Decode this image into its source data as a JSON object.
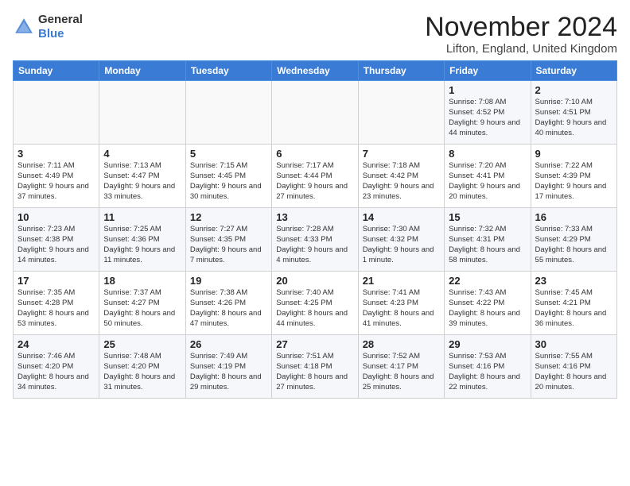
{
  "logo": {
    "general": "General",
    "blue": "Blue"
  },
  "title": "November 2024",
  "location": "Lifton, England, United Kingdom",
  "days_of_week": [
    "Sunday",
    "Monday",
    "Tuesday",
    "Wednesday",
    "Thursday",
    "Friday",
    "Saturday"
  ],
  "weeks": [
    [
      {
        "day": "",
        "info": ""
      },
      {
        "day": "",
        "info": ""
      },
      {
        "day": "",
        "info": ""
      },
      {
        "day": "",
        "info": ""
      },
      {
        "day": "",
        "info": ""
      },
      {
        "day": "1",
        "info": "Sunrise: 7:08 AM\nSunset: 4:52 PM\nDaylight: 9 hours and 44 minutes."
      },
      {
        "day": "2",
        "info": "Sunrise: 7:10 AM\nSunset: 4:51 PM\nDaylight: 9 hours and 40 minutes."
      }
    ],
    [
      {
        "day": "3",
        "info": "Sunrise: 7:11 AM\nSunset: 4:49 PM\nDaylight: 9 hours and 37 minutes."
      },
      {
        "day": "4",
        "info": "Sunrise: 7:13 AM\nSunset: 4:47 PM\nDaylight: 9 hours and 33 minutes."
      },
      {
        "day": "5",
        "info": "Sunrise: 7:15 AM\nSunset: 4:45 PM\nDaylight: 9 hours and 30 minutes."
      },
      {
        "day": "6",
        "info": "Sunrise: 7:17 AM\nSunset: 4:44 PM\nDaylight: 9 hours and 27 minutes."
      },
      {
        "day": "7",
        "info": "Sunrise: 7:18 AM\nSunset: 4:42 PM\nDaylight: 9 hours and 23 minutes."
      },
      {
        "day": "8",
        "info": "Sunrise: 7:20 AM\nSunset: 4:41 PM\nDaylight: 9 hours and 20 minutes."
      },
      {
        "day": "9",
        "info": "Sunrise: 7:22 AM\nSunset: 4:39 PM\nDaylight: 9 hours and 17 minutes."
      }
    ],
    [
      {
        "day": "10",
        "info": "Sunrise: 7:23 AM\nSunset: 4:38 PM\nDaylight: 9 hours and 14 minutes."
      },
      {
        "day": "11",
        "info": "Sunrise: 7:25 AM\nSunset: 4:36 PM\nDaylight: 9 hours and 11 minutes."
      },
      {
        "day": "12",
        "info": "Sunrise: 7:27 AM\nSunset: 4:35 PM\nDaylight: 9 hours and 7 minutes."
      },
      {
        "day": "13",
        "info": "Sunrise: 7:28 AM\nSunset: 4:33 PM\nDaylight: 9 hours and 4 minutes."
      },
      {
        "day": "14",
        "info": "Sunrise: 7:30 AM\nSunset: 4:32 PM\nDaylight: 9 hours and 1 minute."
      },
      {
        "day": "15",
        "info": "Sunrise: 7:32 AM\nSunset: 4:31 PM\nDaylight: 8 hours and 58 minutes."
      },
      {
        "day": "16",
        "info": "Sunrise: 7:33 AM\nSunset: 4:29 PM\nDaylight: 8 hours and 55 minutes."
      }
    ],
    [
      {
        "day": "17",
        "info": "Sunrise: 7:35 AM\nSunset: 4:28 PM\nDaylight: 8 hours and 53 minutes."
      },
      {
        "day": "18",
        "info": "Sunrise: 7:37 AM\nSunset: 4:27 PM\nDaylight: 8 hours and 50 minutes."
      },
      {
        "day": "19",
        "info": "Sunrise: 7:38 AM\nSunset: 4:26 PM\nDaylight: 8 hours and 47 minutes."
      },
      {
        "day": "20",
        "info": "Sunrise: 7:40 AM\nSunset: 4:25 PM\nDaylight: 8 hours and 44 minutes."
      },
      {
        "day": "21",
        "info": "Sunrise: 7:41 AM\nSunset: 4:23 PM\nDaylight: 8 hours and 41 minutes."
      },
      {
        "day": "22",
        "info": "Sunrise: 7:43 AM\nSunset: 4:22 PM\nDaylight: 8 hours and 39 minutes."
      },
      {
        "day": "23",
        "info": "Sunrise: 7:45 AM\nSunset: 4:21 PM\nDaylight: 8 hours and 36 minutes."
      }
    ],
    [
      {
        "day": "24",
        "info": "Sunrise: 7:46 AM\nSunset: 4:20 PM\nDaylight: 8 hours and 34 minutes."
      },
      {
        "day": "25",
        "info": "Sunrise: 7:48 AM\nSunset: 4:20 PM\nDaylight: 8 hours and 31 minutes."
      },
      {
        "day": "26",
        "info": "Sunrise: 7:49 AM\nSunset: 4:19 PM\nDaylight: 8 hours and 29 minutes."
      },
      {
        "day": "27",
        "info": "Sunrise: 7:51 AM\nSunset: 4:18 PM\nDaylight: 8 hours and 27 minutes."
      },
      {
        "day": "28",
        "info": "Sunrise: 7:52 AM\nSunset: 4:17 PM\nDaylight: 8 hours and 25 minutes."
      },
      {
        "day": "29",
        "info": "Sunrise: 7:53 AM\nSunset: 4:16 PM\nDaylight: 8 hours and 22 minutes."
      },
      {
        "day": "30",
        "info": "Sunrise: 7:55 AM\nSunset: 4:16 PM\nDaylight: 8 hours and 20 minutes."
      }
    ]
  ]
}
